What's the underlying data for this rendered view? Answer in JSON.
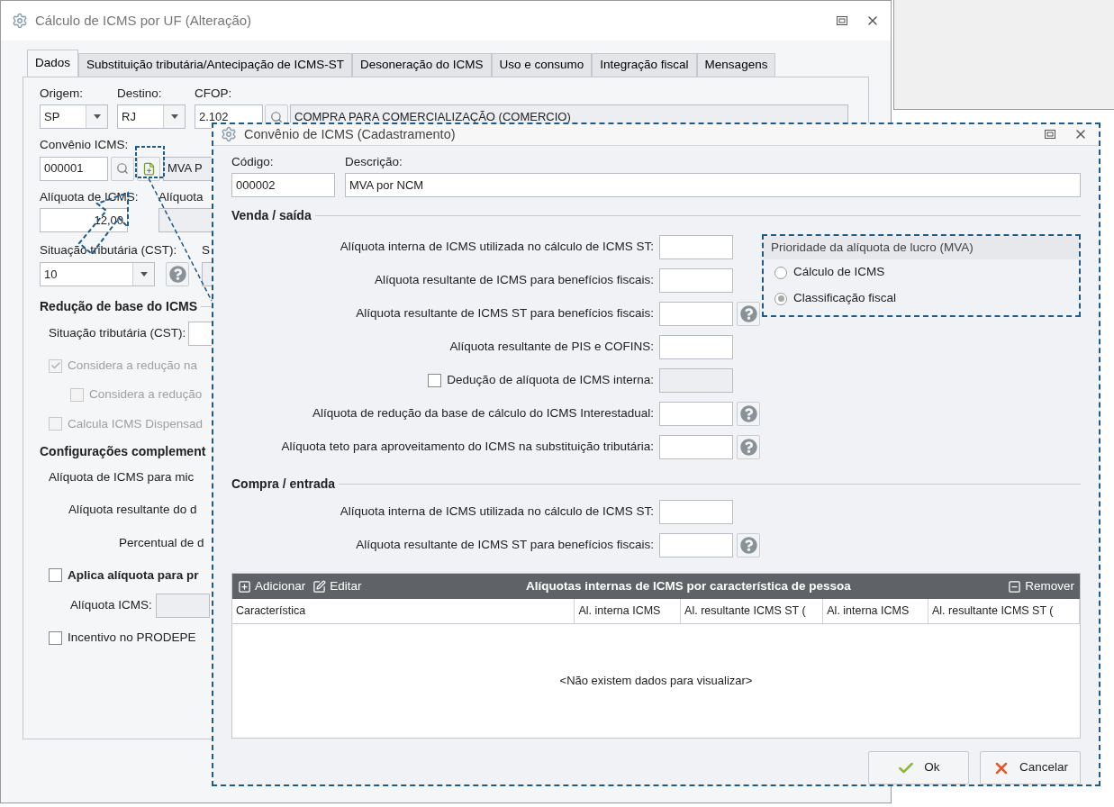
{
  "main_window": {
    "title": "Cálculo de ICMS por UF (Alteração)",
    "tabs": [
      {
        "label": "Dados",
        "selected": true
      },
      {
        "label": "Substituição tributária/Antecipação de ICMS-ST",
        "selected": false
      },
      {
        "label": "Desoneração do ICMS",
        "selected": false
      },
      {
        "label": "Uso e consumo",
        "selected": false
      },
      {
        "label": "Integração fiscal",
        "selected": false
      },
      {
        "label": "Mensagens",
        "selected": false
      }
    ],
    "origem": {
      "label": "Origem:",
      "value": "SP"
    },
    "destino": {
      "label": "Destino:",
      "value": "RJ"
    },
    "cfop": {
      "label": "CFOP:",
      "code": "2.102",
      "description": "COMPRA PARA COMERCIALIZAÇÃO (COMERCIO)"
    },
    "convenio": {
      "label": "Convênio ICMS:",
      "code": "000001",
      "description": "MVA P"
    },
    "aliquota_icms": {
      "label": "Alíquota de ICMS:",
      "value": "12,00"
    },
    "aliquota_2": {
      "label": "Alíquota"
    },
    "cst": {
      "label": "Situação tributária (CST):",
      "value": "10"
    },
    "cst_2": {
      "label": "S"
    },
    "reducao": {
      "title": "Redução de base do ICMS",
      "cst_label": "Situação tributária (CST):",
      "checks": [
        {
          "label": "Considera a redução na",
          "checked": true,
          "disabled": true,
          "children": [
            {
              "label": "Considera a redução",
              "checked": false,
              "disabled": true
            }
          ]
        },
        {
          "label": "Calcula ICMS Dispensad",
          "checked": false,
          "disabled": true
        }
      ]
    },
    "complementares": {
      "title": "Configurações complement",
      "labels": [
        "Alíquota de ICMS para mic",
        "Alíquota resultante do d",
        "Percentual de d"
      ],
      "aplica": {
        "label": "Aplica alíquota para pr",
        "checked": false
      },
      "aliquota_label": "Alíquota ICMS:",
      "prodepe": {
        "label": "Incentivo no PRODEPE",
        "checked": false
      }
    }
  },
  "dialog": {
    "title": "Convênio de ICMS (Cadastramento)",
    "codigo": {
      "label": "Código:",
      "value": "000002"
    },
    "descricao": {
      "label": "Descrição:",
      "value": "MVA por NCM"
    },
    "venda": {
      "title": "Venda / saída",
      "rows": [
        {
          "kind": "field",
          "label": "Alíquota interna de ICMS utilizada no cálculo de ICMS ST:",
          "help": false
        },
        {
          "kind": "field",
          "label": "Alíquota resultante de ICMS para benefícios fiscais:",
          "help": false
        },
        {
          "kind": "field",
          "label": "Alíquota resultante de ICMS ST para benefícios fiscais:",
          "help": true
        },
        {
          "kind": "field",
          "label": "Alíquota resultante de PIS e COFINS:",
          "help": false
        },
        {
          "kind": "check",
          "label": "Dedução de alíquota de ICMS interna:",
          "checked": false,
          "help": false
        },
        {
          "kind": "field",
          "label": "Alíquota de redução da base de cálculo do ICMS Interestadual:",
          "help": true
        },
        {
          "kind": "field",
          "label": "Alíquota teto para aproveitamento do ICMS na substituição tributária:",
          "help": true
        }
      ]
    },
    "prioridade": {
      "title": "Prioridade da alíquota de lucro (MVA)",
      "options": [
        {
          "label": "Cálculo de ICMS",
          "selected": false
        },
        {
          "label": "Classificação fiscal",
          "selected": true
        }
      ]
    },
    "compra": {
      "title": "Compra / entrada",
      "rows": [
        {
          "kind": "field",
          "label": "Alíquota interna de ICMS utilizada no cálculo de ICMS ST:",
          "help": false
        },
        {
          "kind": "field",
          "label": "Alíquota resultante de ICMS ST para benefícios fiscais:",
          "help": true
        }
      ]
    },
    "table": {
      "title": "Alíquotas internas de ICMS por característica de pessoa",
      "actions": [
        {
          "kind": "add",
          "label": "Adicionar"
        },
        {
          "kind": "edit",
          "label": "Editar"
        }
      ],
      "remove": {
        "label": "Remover"
      },
      "columns": [
        "Característica",
        "Al. interna ICMS",
        "Al. resultante ICMS ST (",
        "Al. interna ICMS",
        "Al. resultante ICMS ST ("
      ],
      "empty": "<Não existem dados para visualizar>"
    },
    "buttons": [
      {
        "kind": "ok",
        "label": "Ok"
      },
      {
        "kind": "cancel",
        "label": "Cancelar"
      }
    ]
  }
}
